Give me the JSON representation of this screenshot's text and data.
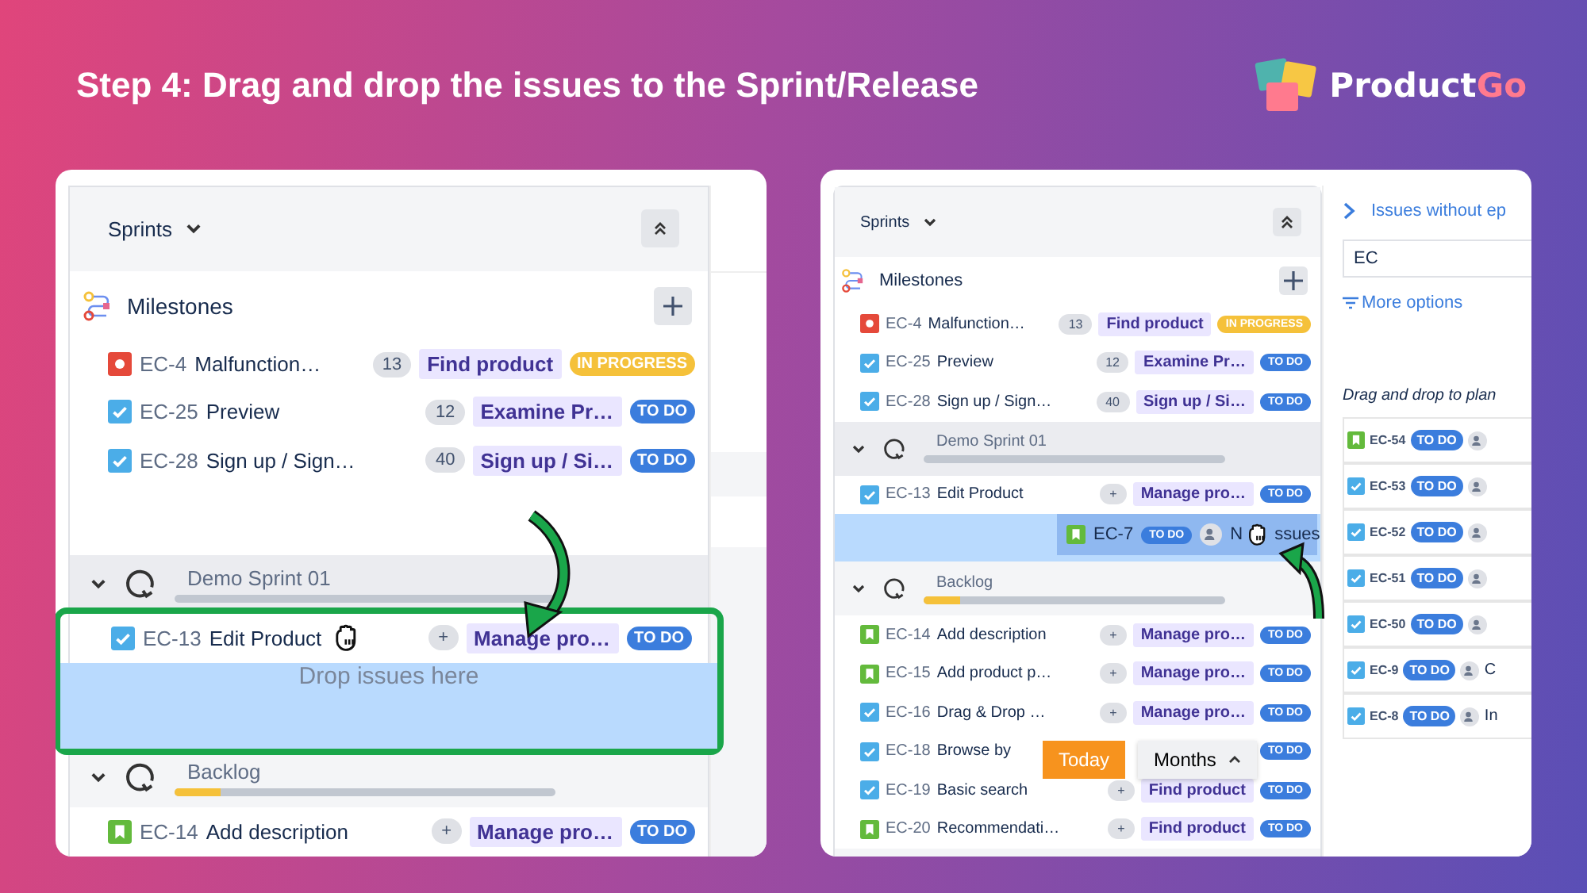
{
  "header": {
    "title": "Step 4: Drag and drop the issues to the Sprint/Release",
    "logo_main": "Product",
    "logo_accent": "Go"
  },
  "panels": [
    {
      "sprints_label": "Sprints",
      "milestones_label": "Milestones",
      "milestone_issues": [
        {
          "kind": "bug",
          "key": "EC-4",
          "title": "Malfunction…",
          "count": "13",
          "epic": "Find product",
          "status": "IN PROGRESS",
          "color": "#f5c13a",
          "dragging": false
        },
        {
          "kind": "task",
          "key": "EC-25",
          "title": "Preview",
          "count": "12",
          "epic": "Examine Pr…",
          "status": "TO DO",
          "color": "#3b7ddd",
          "dragging": false
        },
        {
          "kind": "task",
          "key": "EC-28",
          "title": "Sign up / Sign…",
          "count": "40",
          "epic": "Sign up / Si…",
          "status": "TO DO",
          "color": "#3b7ddd",
          "dragging": false
        }
      ],
      "groups": [
        {
          "name": "Demo Sprint 01",
          "level": 0,
          "highlighted": true,
          "drop_hint": "Drop issues here",
          "issues": [
            {
              "kind": "task",
              "key": "EC-13",
              "title": "Edit Product",
              "count": "+",
              "epic": "Manage pro…",
              "status": "TO DO",
              "color": "#3b7ddd",
              "dragging": true
            }
          ]
        },
        {
          "name": "Backlog",
          "level": 0.12,
          "highlighted": false,
          "issues": [
            {
              "kind": "story",
              "key": "EC-14",
              "title": "Add description",
              "count": "+",
              "epic": "Manage pro…",
              "status": "TO DO",
              "color": "#3b7ddd",
              "dragging": false
            }
          ]
        }
      ]
    },
    {
      "sprints_label": "Sprints",
      "milestones_label": "Milestones",
      "milestone_issues": [
        {
          "kind": "bug",
          "key": "EC-4",
          "title": "Malfunction…",
          "count": "13",
          "epic": "Find product",
          "status": "IN PROGRESS",
          "color": "#f5c13a",
          "dragging": false
        },
        {
          "kind": "task",
          "key": "EC-25",
          "title": "Preview",
          "count": "12",
          "epic": "Examine Pr…",
          "status": "TO DO",
          "color": "#3b7ddd",
          "dragging": false
        },
        {
          "kind": "task",
          "key": "EC-28",
          "title": "Sign up / Sign…",
          "count": "40",
          "epic": "Sign up / Si…",
          "status": "TO DO",
          "color": "#3b7ddd",
          "dragging": false
        }
      ],
      "groups": [
        {
          "name": "Demo Sprint 01",
          "level": 0,
          "highlighted": false,
          "drag_ghost": {
            "kind": "story",
            "key": "EC-7",
            "status": "TO DO",
            "title_start": "N",
            "title_end": "ssues"
          },
          "issues": [
            {
              "kind": "task",
              "key": "EC-13",
              "title": "Edit Product",
              "count": "+",
              "epic": "Manage pro…",
              "status": "TO DO",
              "color": "#3b7ddd",
              "dragging": false
            }
          ]
        },
        {
          "name": "Backlog",
          "level": 0.12,
          "highlighted": false,
          "issues": [
            {
              "kind": "story",
              "key": "EC-14",
              "title": "Add description",
              "count": "+",
              "epic": "Manage pro…",
              "status": "TO DO",
              "color": "#3b7ddd",
              "dragging": false
            },
            {
              "kind": "story",
              "key": "EC-15",
              "title": "Add product p…",
              "count": "+",
              "epic": "Manage pro…",
              "status": "TO DO",
              "color": "#3b7ddd",
              "dragging": false
            },
            {
              "kind": "task",
              "key": "EC-16",
              "title": "Drag & Drop …",
              "count": "+",
              "epic": "Manage pro…",
              "status": "TO DO",
              "color": "#3b7ddd",
              "dragging": false
            },
            {
              "kind": "task",
              "key": "EC-18",
              "title": "Browse by",
              "status": "TO DO",
              "color": "#3b7ddd",
              "dragging": false
            },
            {
              "kind": "task",
              "key": "EC-19",
              "title": "Basic search",
              "count": "+",
              "epic": "Find product",
              "status": "TO DO",
              "color": "#3b7ddd",
              "dragging": false
            },
            {
              "kind": "story",
              "key": "EC-20",
              "title": "Recommendati…",
              "count": "+",
              "epic": "Find product",
              "status": "TO DO",
              "color": "#3b7ddd",
              "dragging": false
            }
          ]
        }
      ],
      "overlay_buttons": {
        "today": "Today",
        "zoom": "Months"
      },
      "side": {
        "link": "Issues without ep",
        "search": "EC",
        "more": "More options",
        "hint": "Drag and drop to plan",
        "items": [
          {
            "kind": "story",
            "key": "EC-54",
            "status": "TO DO"
          },
          {
            "kind": "task",
            "key": "EC-53",
            "status": "TO DO"
          },
          {
            "kind": "task",
            "key": "EC-52",
            "status": "TO DO"
          },
          {
            "kind": "task",
            "key": "EC-51",
            "status": "TO DO"
          },
          {
            "kind": "task",
            "key": "EC-50",
            "status": "TO DO"
          },
          {
            "kind": "task",
            "key": "EC-9",
            "status": "TO DO",
            "text": "C"
          },
          {
            "kind": "task",
            "key": "EC-8",
            "status": "TO DO",
            "text": "In"
          }
        ]
      }
    }
  ]
}
